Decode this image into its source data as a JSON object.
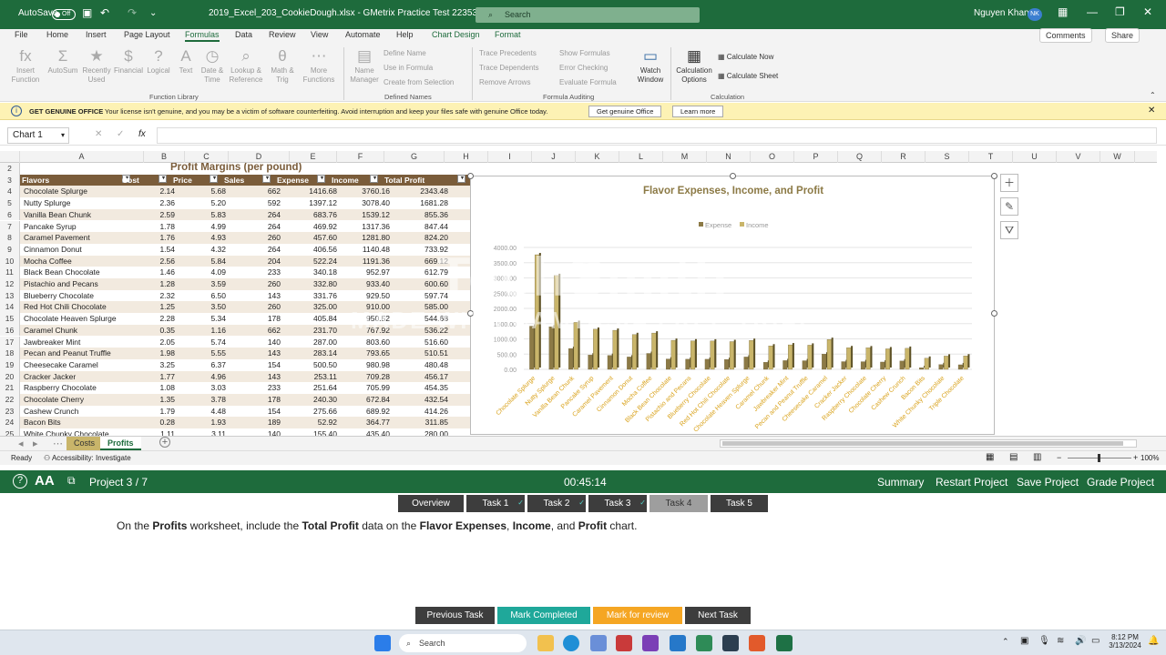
{
  "titlebar": {
    "autosave": "AutoSave",
    "toggle": "Off",
    "filename": "2019_Excel_203_CookieDough.xlsx - GMetrix Practice Test 223538",
    "search": "Search",
    "user": "Nguyen Khang",
    "initials": "NK"
  },
  "menus": [
    "File",
    "Home",
    "Insert",
    "Page Layout",
    "Formulas",
    "Data",
    "Review",
    "View",
    "Automate",
    "Help",
    "Chart Design",
    "Format"
  ],
  "menu_buttons": {
    "comments": "Comments",
    "share": "Share"
  },
  "ribbon": {
    "function_library": [
      {
        "label": "Insert\nFunction",
        "glyph": "fx"
      },
      {
        "label": "AutoSum",
        "glyph": "Σ"
      },
      {
        "label": "Recently\nUsed",
        "glyph": "★"
      },
      {
        "label": "Financial",
        "glyph": "$"
      },
      {
        "label": "Logical",
        "glyph": "?"
      },
      {
        "label": "Text",
        "glyph": "A"
      },
      {
        "label": "Date &\nTime",
        "glyph": "◷"
      },
      {
        "label": "Lookup &\nReference",
        "glyph": "⌕"
      },
      {
        "label": "Math &\nTrig",
        "glyph": "θ"
      },
      {
        "label": "More\nFunctions",
        "glyph": "⋯"
      }
    ],
    "defined_names": {
      "name_manager": "Name\nManager",
      "define_name": "Define Name",
      "use_in_formula": "Use in Formula",
      "create": "Create from Selection"
    },
    "auditing": {
      "trace_prec": "Trace Precedents",
      "trace_dep": "Trace Dependents",
      "remove": "Remove Arrows",
      "show": "Show Formulas",
      "error": "Error Checking",
      "evaluate": "Evaluate Formula",
      "watch": "Watch\nWindow"
    },
    "calculation": {
      "options": "Calculation\nOptions",
      "now": "Calculate Now",
      "sheet": "Calculate Sheet"
    },
    "groups": [
      "Function Library",
      "Defined Names",
      "Formula Auditing",
      "Calculation"
    ]
  },
  "message": {
    "title": "GET GENUINE OFFICE",
    "text": "Your license isn't genuine, and you may be a victim of software counterfeiting. Avoid interruption and keep your files safe with genuine Office today.",
    "btn1": "Get genuine Office",
    "btn2": "Learn more"
  },
  "namebox": "Chart 1",
  "columns": [
    "A",
    "B",
    "C",
    "D",
    "E",
    "F",
    "G",
    "H",
    "I",
    "J",
    "K",
    "L",
    "M",
    "N",
    "O",
    "P",
    "Q",
    "R",
    "S",
    "T",
    "U",
    "V",
    "W"
  ],
  "sheet": {
    "title": "Profit Margins (per pound)",
    "headers": [
      "Flavors",
      "Cost",
      "Price",
      "Sales",
      "Expense",
      "Income",
      "Total Profit"
    ],
    "rows": [
      [
        "Chocolate Splurge",
        "2.14",
        "5.68",
        "662",
        "1416.68",
        "3760.16",
        "2343.48"
      ],
      [
        "Nutty Splurge",
        "2.36",
        "5.20",
        "592",
        "1397.12",
        "3078.40",
        "1681.28"
      ],
      [
        "Vanilla Bean Chunk",
        "2.59",
        "5.83",
        "264",
        "683.76",
        "1539.12",
        "855.36"
      ],
      [
        "Pancake Syrup",
        "1.78",
        "4.99",
        "264",
        "469.92",
        "1317.36",
        "847.44"
      ],
      [
        "Caramel Pavement",
        "1.76",
        "4.93",
        "260",
        "457.60",
        "1281.80",
        "824.20"
      ],
      [
        "Cinnamon Donut",
        "1.54",
        "4.32",
        "264",
        "406.56",
        "1140.48",
        "733.92"
      ],
      [
        "Mocha Coffee",
        "2.56",
        "5.84",
        "204",
        "522.24",
        "1191.36",
        "669.12"
      ],
      [
        "Black Bean Chocolate",
        "1.46",
        "4.09",
        "233",
        "340.18",
        "952.97",
        "612.79"
      ],
      [
        "Pistachio and Pecans",
        "1.28",
        "3.59",
        "260",
        "332.80",
        "933.40",
        "600.60"
      ],
      [
        "Blueberry Chocolate",
        "2.32",
        "6.50",
        "143",
        "331.76",
        "929.50",
        "597.74"
      ],
      [
        "Red Hot Chili Chocolate",
        "1.25",
        "3.50",
        "260",
        "325.00",
        "910.00",
        "585.00"
      ],
      [
        "Chocolate Heaven Splurge",
        "2.28",
        "5.34",
        "178",
        "405.84",
        "950.52",
        "544.68"
      ],
      [
        "Caramel Chunk",
        "0.35",
        "1.16",
        "662",
        "231.70",
        "767.92",
        "536.22"
      ],
      [
        "Jawbreaker Mint",
        "2.05",
        "5.74",
        "140",
        "287.00",
        "803.60",
        "516.60"
      ],
      [
        "Pecan and Peanut Truffle",
        "1.98",
        "5.55",
        "143",
        "283.14",
        "793.65",
        "510.51"
      ],
      [
        "Cheesecake Caramel",
        "3.25",
        "6.37",
        "154",
        "500.50",
        "980.98",
        "480.48"
      ],
      [
        "Cracker Jacker",
        "1.77",
        "4.96",
        "143",
        "253.11",
        "709.28",
        "456.17"
      ],
      [
        "Raspberry Chocolate",
        "1.08",
        "3.03",
        "233",
        "251.64",
        "705.99",
        "454.35"
      ],
      [
        "Chocolate Cherry",
        "1.35",
        "3.78",
        "178",
        "240.30",
        "672.84",
        "432.54"
      ],
      [
        "Cashew Crunch",
        "1.79",
        "4.48",
        "154",
        "275.66",
        "689.92",
        "414.26"
      ],
      [
        "Bacon Bits",
        "0.28",
        "1.93",
        "189",
        "52.92",
        "364.77",
        "311.85"
      ],
      [
        "White Chunky Chocolate",
        "1.11",
        "3.11",
        "140",
        "155.40",
        "435.40",
        "280.00"
      ]
    ]
  },
  "chart_data": {
    "type": "bar",
    "title": "Flavor Expenses, Income, and Profit",
    "categories": [
      "Chocolate Splurge",
      "Nutty Splurge",
      "Vanilla Bean Chunk",
      "Pancake Syrup",
      "Caramel Pavement",
      "Cinnamon Donut",
      "Mocha Coffee",
      "Black Bean Chocolate",
      "Pistachio and Pecans",
      "Blueberry Chocolate",
      "Red Hot Chili Chocolate",
      "Chocolate Heaven Splurge",
      "Caramel Chunk",
      "Jawbreaker Mint",
      "Pecan and Peanut Truffle",
      "Cheesecake Caramel",
      "Cracker Jacker",
      "Raspberry Chocolate",
      "Chocolate Cherry",
      "Cashew Crunch",
      "Bacon Bits",
      "White Chunky Chocolate",
      "Triple Chocolate"
    ],
    "series": [
      {
        "name": "Expense",
        "color": "#8c7a46",
        "values": [
          1416.68,
          1397.12,
          683.76,
          469.92,
          457.6,
          406.56,
          522.24,
          340.18,
          332.8,
          331.76,
          325,
          405.84,
          231.7,
          287,
          283.14,
          500.5,
          253.11,
          251.64,
          240.3,
          275.66,
          52.92,
          155.4,
          150
        ]
      },
      {
        "name": "Income",
        "color": "#c9b56a",
        "values": [
          3760.16,
          3078.4,
          1539.12,
          1317.36,
          1281.8,
          1140.48,
          1191.36,
          952.97,
          933.4,
          929.5,
          910,
          950.52,
          767.92,
          803.6,
          793.65,
          980.98,
          709.28,
          705.99,
          672.84,
          689.92,
          364.77,
          435.4,
          440
        ]
      }
    ],
    "yticks": [
      "4000.00",
      "3500.00",
      "3000.00",
      "2500.00",
      "2000.00",
      "1500.00",
      "1000.00",
      "500.00",
      "0.00"
    ],
    "ylim": [
      0,
      4000
    ],
    "legend": "top"
  },
  "sheet_tabs": [
    "Costs",
    "Profits"
  ],
  "status": {
    "ready": "Ready",
    "accessibility": "Accessibility: Investigate",
    "zoom": "100%"
  },
  "gmetrix": {
    "project": "Project 3 / 7",
    "timer": "00:45:14",
    "summary": "Summary",
    "restart": "Restart Project",
    "save": "Save Project",
    "grade": "Grade Project"
  },
  "tasks": [
    {
      "label": "Overview",
      "done": false
    },
    {
      "label": "Task 1",
      "done": true
    },
    {
      "label": "Task 2",
      "done": true
    },
    {
      "label": "Task 3",
      "done": true
    },
    {
      "label": "Task 4",
      "done": false
    },
    {
      "label": "Task 5",
      "done": false
    }
  ],
  "instruction": {
    "p1": "On the ",
    "b1": "Profits",
    "p2": " worksheet, include the ",
    "b2": "Total Profit",
    "p3": " data on the ",
    "b3": "Flavor Expenses",
    "p4": ", ",
    "b4": "Income",
    "p5": ", and ",
    "b5": "Profit",
    "p6": " chart."
  },
  "footer_buttons": {
    "prev": "Previous Task",
    "complete": "Mark Completed",
    "review": "Mark for review",
    "next": "Next Task"
  },
  "taskbar": {
    "search": "Search",
    "time": "8:12 PM",
    "date": "3/13/2024"
  },
  "watermark": {
    "line1": "TechSmith",
    "line2": "MADE WITH CAMTASIA FREE TRIAL"
  }
}
